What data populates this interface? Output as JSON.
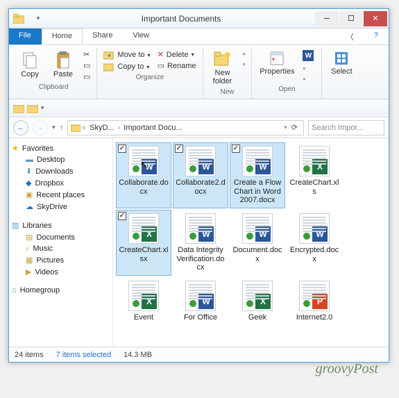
{
  "window": {
    "title": "Important Documents"
  },
  "tabs": {
    "file": "File",
    "home": "Home",
    "share": "Share",
    "view": "View"
  },
  "ribbon": {
    "clipboard": {
      "copy": "Copy",
      "paste": "Paste",
      "cut": "",
      "copypath": "",
      "pasteShortcut": "",
      "label": "Clipboard"
    },
    "organize": {
      "moveto": "Move to",
      "copyto": "Copy to",
      "delete": "Delete",
      "rename": "Rename",
      "label": "Organize"
    },
    "new": {
      "newfolder": "New\nfolder",
      "label": "New"
    },
    "open": {
      "properties": "Properties",
      "label": "Open"
    },
    "select": {
      "select": "Select",
      "label": ""
    }
  },
  "address": {
    "seg1": "SkyD...",
    "seg2": "Important Docu...",
    "refresh": "⟳",
    "search_placeholder": "Search Impor..."
  },
  "sidebar": {
    "favorites": "Favorites",
    "desktop": "Desktop",
    "downloads": "Downloads",
    "dropbox": "Dropbox",
    "recent": "Recent places",
    "skydrive": "SkyDrive",
    "libraries": "Libraries",
    "documents": "Documents",
    "music": "Music",
    "pictures": "Pictures",
    "videos": "Videos",
    "homegroup": "Homegroup"
  },
  "files": [
    {
      "name": "Collaborate.docx",
      "type": "word",
      "selected": true,
      "checked": true,
      "cursor": true
    },
    {
      "name": "Collaborate2.docx",
      "type": "word",
      "selected": true,
      "checked": true
    },
    {
      "name": "Create a Flow Chart in Word 2007.docx",
      "type": "word",
      "selected": true,
      "checked": true
    },
    {
      "name": "CreateChart.xls",
      "type": "excel",
      "selected": false
    },
    {
      "name": "CreateChart.xlsx",
      "type": "excel",
      "selected": true,
      "checked": true
    },
    {
      "name": "Data Integrity Verification.docx",
      "type": "word",
      "selected": false
    },
    {
      "name": "Document.docx",
      "type": "word",
      "selected": false
    },
    {
      "name": "Encrypted.docx",
      "type": "word",
      "selected": false
    },
    {
      "name": "Event",
      "type": "excel",
      "selected": false
    },
    {
      "name": "For Office",
      "type": "word",
      "selected": false
    },
    {
      "name": "Geek",
      "type": "excel",
      "selected": false
    },
    {
      "name": "Internet2.0",
      "type": "ppt",
      "selected": false
    }
  ],
  "status": {
    "items": "24 items",
    "selected": "7 items selected",
    "size": "14.3 MB"
  },
  "watermark": "groovyPost"
}
